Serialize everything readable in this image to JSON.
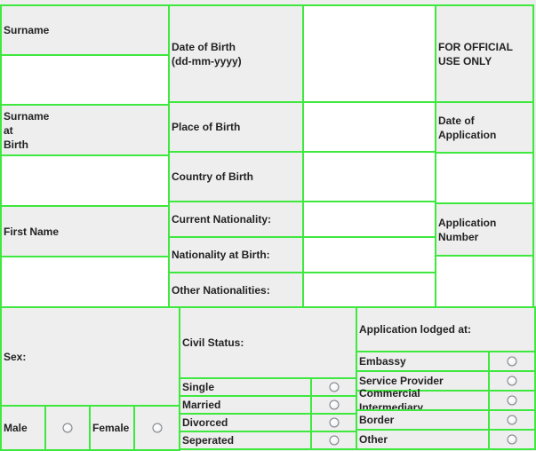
{
  "labels": {
    "surname": "Surname",
    "surname_at_birth": "Surname\nat\nBirth",
    "first_name": "First Name",
    "date_of_birth": "Date of Birth\n(dd-mm-yyyy)",
    "place_of_birth": "Place of Birth",
    "country_of_birth": "Country of Birth",
    "current_nationality": "Current Nationality:",
    "nationality_at_birth": "Nationality at Birth:",
    "other_nationalities": "Other Nationalities:",
    "official_use": "FOR OFFICIAL\nUSE ONLY",
    "date_of_application": "Date of\nApplication",
    "application_number": "Application\nNumber",
    "sex": "Sex:",
    "male": "Male",
    "female": "Female",
    "civil_status": "Civil Status:",
    "application_lodged_at": "Application lodged at:"
  },
  "civil_status_options": [
    "Single",
    "Married",
    "Divorced",
    "Seperated"
  ],
  "lodged_options": [
    "Embassy",
    "Service Provider",
    "Commercial Intermediary",
    "Border",
    "Other"
  ]
}
